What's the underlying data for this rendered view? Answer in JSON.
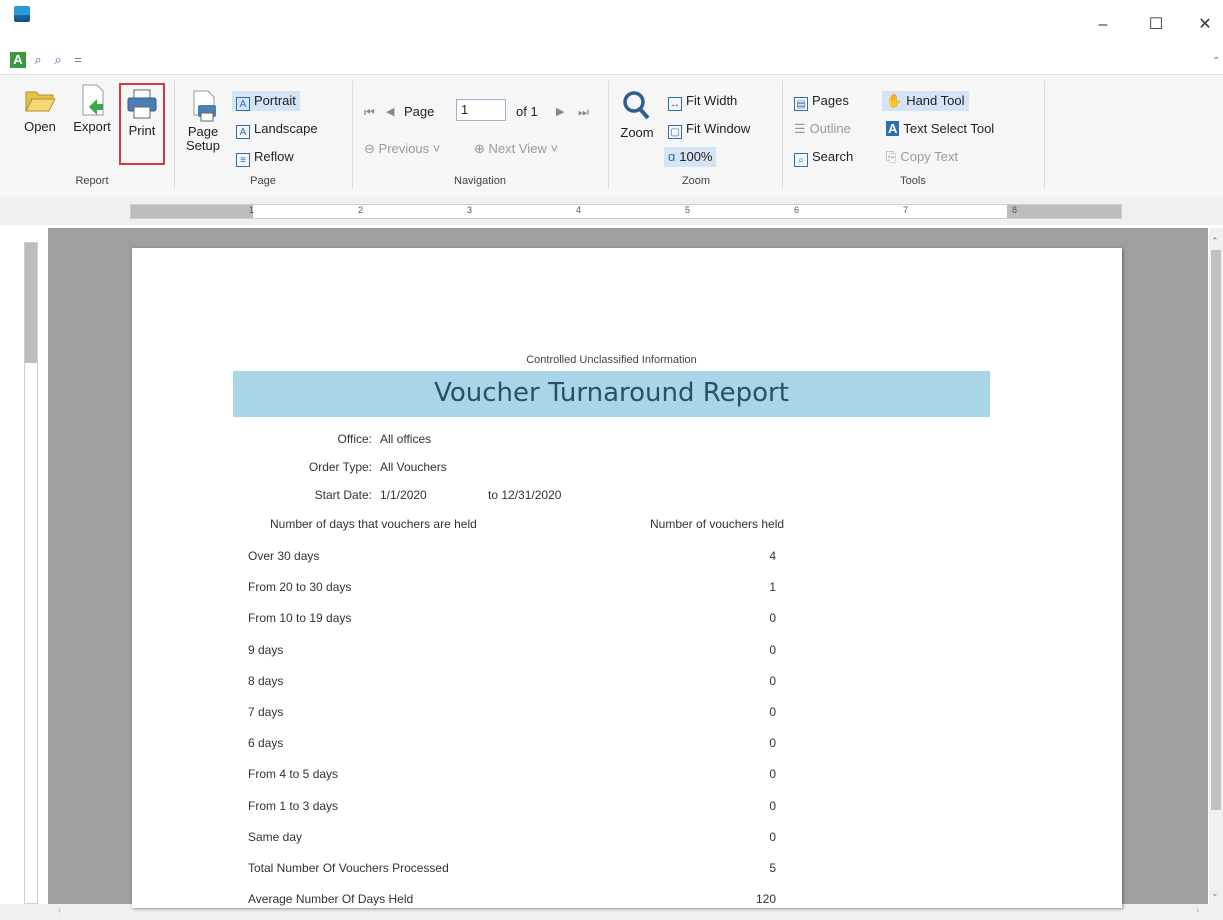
{
  "window": {
    "minimize": "–",
    "maximize": "☐",
    "close": "✕"
  },
  "qat": {
    "dropdown": "="
  },
  "ribbon": {
    "report_group": {
      "label": "Report",
      "open": "Open",
      "export": "Export",
      "print": "Print"
    },
    "page_group": {
      "label": "Page",
      "page_setup_line1": "Page",
      "page_setup_line2": "Setup",
      "portrait": "Portrait",
      "landscape": "Landscape",
      "reflow": "Reflow"
    },
    "navigation_group": {
      "label": "Navigation",
      "page_label": "Page",
      "page_value": "1",
      "of_label": "of 1",
      "previous": "Previous",
      "next_view": "Next View"
    },
    "zoom_group": {
      "label": "Zoom",
      "zoom": "Zoom",
      "fit_width": "Fit Width",
      "fit_window": "Fit Window",
      "zoom_100": "100%"
    },
    "tools_group": {
      "label": "Tools",
      "pages": "Pages",
      "outline": "Outline",
      "search": "Search",
      "hand_tool": "Hand Tool",
      "text_select_tool": "Text Select Tool",
      "copy_text": "Copy Text"
    }
  },
  "ruler": {
    "marks": [
      "1",
      "2",
      "3",
      "4",
      "5",
      "6",
      "7",
      "8"
    ]
  },
  "report": {
    "classification": "Controlled Unclassified Information",
    "title": "Voucher Turnaround Report",
    "office_label": "Office:",
    "office_value": "All offices",
    "order_type_label": "Order Type:",
    "order_type_value": "All Vouchers",
    "start_date_label": "Start Date:",
    "start_date_value": "1/1/2020",
    "end_date_value": "to 12/31/2020",
    "col_days_header": "Number of days that vouchers are held",
    "col_count_header": "Number of vouchers held",
    "rows": [
      {
        "label": "Over 30 days",
        "value": "4"
      },
      {
        "label": "From 20 to 30 days",
        "value": "1"
      },
      {
        "label": "From 10 to 19 days",
        "value": "0"
      },
      {
        "label": "9 days",
        "value": "0"
      },
      {
        "label": "8 days",
        "value": "0"
      },
      {
        "label": "7 days",
        "value": "0"
      },
      {
        "label": "6 days",
        "value": "0"
      },
      {
        "label": "From 4 to 5 days",
        "value": "0"
      },
      {
        "label": "From 1 to 3 days",
        "value": "0"
      },
      {
        "label": "Same day",
        "value": "0"
      },
      {
        "label": "Total Number Of Vouchers Processed",
        "value": "5"
      },
      {
        "label": "Average Number Of Days Held",
        "value": "120"
      }
    ]
  },
  "colors": {
    "title_band": "#a9d6e6",
    "title_text": "#2a4f69",
    "selected": "#d5e4f5",
    "print_highlight": "#d9363e"
  }
}
